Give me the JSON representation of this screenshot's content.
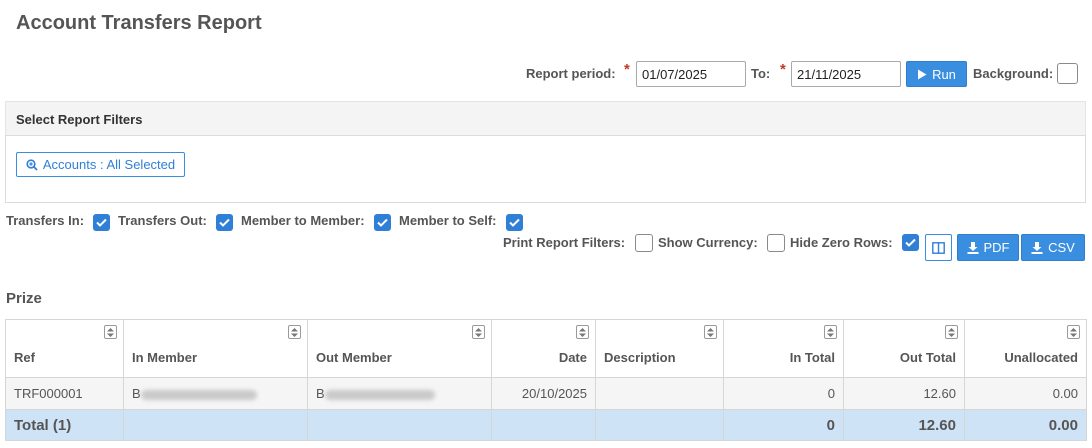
{
  "page": {
    "title": "Account Transfers Report"
  },
  "period": {
    "label": "Report period:",
    "from_value": "01/07/2025",
    "to_label": "To:",
    "to_value": "21/11/2025",
    "run_label": "Run",
    "background_label": "Background:"
  },
  "filters": {
    "header": "Select Report Filters",
    "accounts_label": "Accounts : All Selected"
  },
  "options": {
    "transfers_in": "Transfers In:",
    "transfers_out": "Transfers Out:",
    "member_to_member": "Member to Member:",
    "member_to_self": "Member to Self:",
    "print_report_filters": "Print Report Filters:",
    "show_currency": "Show Currency:",
    "hide_zero_rows": "Hide Zero Rows:",
    "pdf_label": "PDF",
    "csv_label": "CSV"
  },
  "section": {
    "title": "Prize"
  },
  "table": {
    "columns": [
      "Ref",
      "In Member",
      "Out Member",
      "Date",
      "Description",
      "In Total",
      "Out Total",
      "Unallocated"
    ],
    "rows": [
      {
        "ref": "TRF000001",
        "in_member": "B",
        "out_member": "B",
        "date": "20/10/2025",
        "description": "",
        "in_total": "0",
        "out_total": "12.60",
        "unallocated": "0.00"
      }
    ],
    "total": {
      "label": "Total (1)",
      "in_total": "0",
      "out_total": "12.60",
      "unallocated": "0.00"
    }
  },
  "colors": {
    "accent": "#3a8ee0",
    "total_row": "#cfe3f7",
    "required": "#c0392b"
  },
  "icons": {
    "run": "play-icon",
    "accounts": "magnifier-plus-icon",
    "columns": "columns-icon",
    "pdf": "download-icon",
    "csv": "download-icon"
  }
}
